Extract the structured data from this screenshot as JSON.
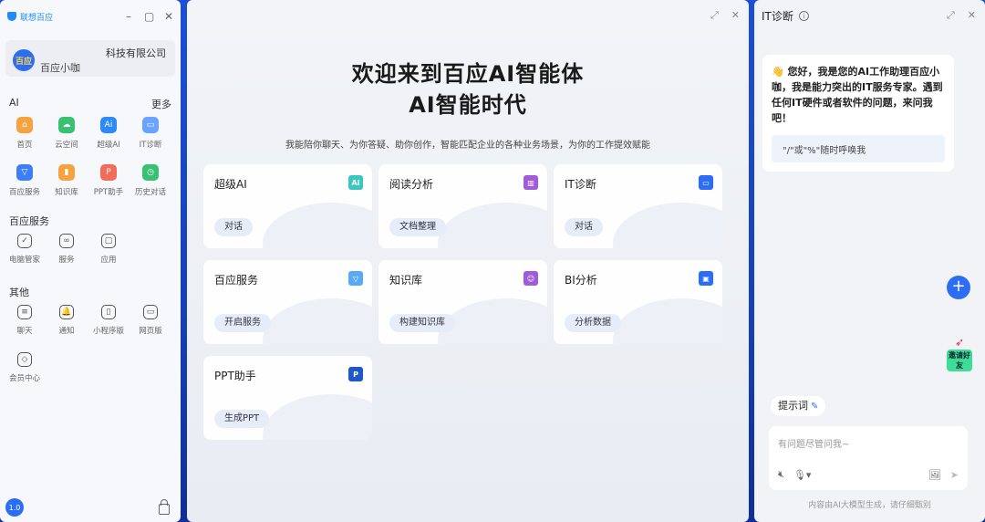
{
  "left": {
    "logo_text": "联想百应",
    "window_controls": [
      "minimize",
      "maximize",
      "close"
    ],
    "profile": {
      "company": "科技有限公司",
      "avatar_text": "百应",
      "name": "百应小咖"
    },
    "ai_section": {
      "title": "AI",
      "more": "更多",
      "items": [
        {
          "label": "首页",
          "icon": "home-icon",
          "color": "#f5a340",
          "glyph": "⌂"
        },
        {
          "label": "云空间",
          "icon": "cloud-space-icon",
          "color": "#38c172",
          "glyph": "☁"
        },
        {
          "label": "超级AI",
          "icon": "super-ai-icon",
          "color": "#2b8af5",
          "glyph": "Ai"
        },
        {
          "label": "IT诊断",
          "icon": "it-diagnosis-icon",
          "color": "#6ba4ff",
          "glyph": "▭"
        },
        {
          "label": "百应服务",
          "icon": "service-icon",
          "color": "#3d7df5",
          "glyph": "▽"
        },
        {
          "label": "知识库",
          "icon": "knowledge-icon",
          "color": "#f5a340",
          "glyph": "▮"
        },
        {
          "label": "PPT助手",
          "icon": "ppt-icon",
          "color": "#f26b5b",
          "glyph": "P"
        },
        {
          "label": "历史对话",
          "icon": "history-icon",
          "color": "#38c172",
          "glyph": "◷"
        }
      ]
    },
    "service_section": {
      "title": "百应服务",
      "items": [
        {
          "label": "电脑管家",
          "icon": "shield-icon",
          "glyph": "✓"
        },
        {
          "label": "服务",
          "icon": "service-link-icon",
          "glyph": "∞"
        },
        {
          "label": "应用",
          "icon": "bag-icon",
          "glyph": "▢"
        }
      ]
    },
    "other_section": {
      "title": "其他",
      "items": [
        {
          "label": "聊天",
          "icon": "chat-icon",
          "glyph": "≡"
        },
        {
          "label": "通知",
          "icon": "bell-icon",
          "glyph": "🔔"
        },
        {
          "label": "小程序版",
          "icon": "mini-program-icon",
          "glyph": "▯"
        },
        {
          "label": "网页版",
          "icon": "web-version-icon",
          "glyph": "▭"
        },
        {
          "label": "会员中心",
          "icon": "membership-icon",
          "glyph": "◇"
        }
      ]
    },
    "bottom_badge": "1.0"
  },
  "main": {
    "title_line1": "欢迎来到百应AI智能体",
    "title_line2": "AI智能时代",
    "subtitle": "我能陪你聊天、为你答疑、助你创作，智能匹配企业的各种业务场景，为你的工作提效赋能",
    "cards": [
      {
        "title": "超级AI",
        "tag": "对话",
        "icon": "super-ai-card-icon",
        "color": "#3cc6c0",
        "glyph": "Ai"
      },
      {
        "title": "阅读分析",
        "tag": "文档整理",
        "icon": "reading-icon",
        "color": "#a05bd6",
        "glyph": "▥"
      },
      {
        "title": "IT诊断",
        "tag": "对话",
        "icon": "it-card-icon",
        "color": "#2b6df5",
        "glyph": "▭"
      },
      {
        "title": "百应服务",
        "tag": "开启服务",
        "icon": "service-card-icon",
        "color": "#5aa9f5",
        "glyph": "▽"
      },
      {
        "title": "知识库",
        "tag": "构建知识库",
        "icon": "knowledge-card-icon",
        "color": "#a05bd6",
        "glyph": "☺"
      },
      {
        "title": "BI分析",
        "tag": "分析数据",
        "icon": "bi-icon",
        "color": "#2b6df5",
        "glyph": "▣"
      },
      {
        "title": "PPT助手",
        "tag": "生成PPT",
        "icon": "ppt-card-icon",
        "color": "#1f57c8",
        "glyph": "P"
      }
    ]
  },
  "assistant": {
    "title": "IT诊断",
    "greeting": "👋 您好，我是您的AI工作助理百应小咖，我是能力突出的IT服务专家。遇到任何IT硬件或者软件的问题，来问我吧！",
    "hint": "\"/\"或\"%\"随时呼唤我",
    "invite_text": "邀请好友",
    "prompt_chip": "提示词",
    "input_placeholder": "有问题尽管问我~",
    "footnote": "内容由AI大模型生成，请仔细甄别"
  }
}
